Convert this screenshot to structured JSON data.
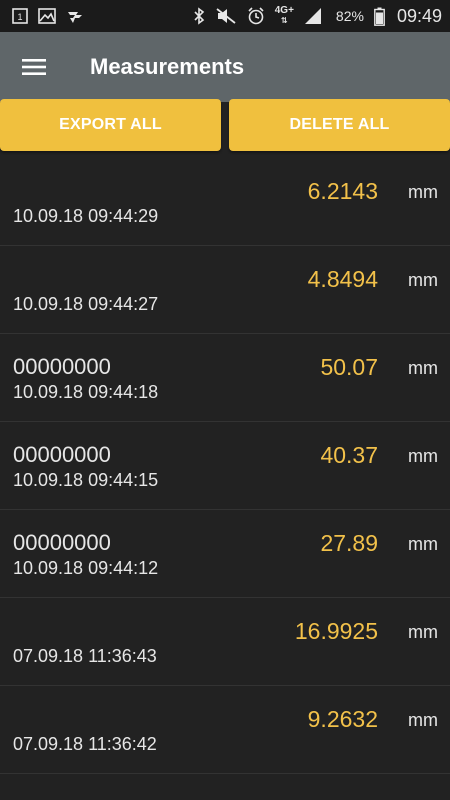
{
  "status_bar": {
    "battery_percent": "82%",
    "time": "09:49",
    "network": "4G+"
  },
  "toolbar": {
    "title": "Measurements"
  },
  "actions": {
    "export_label": "EXPORT ALL",
    "delete_label": "DELETE ALL"
  },
  "accent_color": "#f0c03e",
  "measurements": [
    {
      "name": "",
      "date": "10.09.18 09:44:29",
      "value": "6.2143",
      "unit": "mm"
    },
    {
      "name": "",
      "date": "10.09.18 09:44:27",
      "value": "4.8494",
      "unit": "mm"
    },
    {
      "name": "00000000",
      "date": "10.09.18 09:44:18",
      "value": "50.07",
      "unit": "mm"
    },
    {
      "name": "00000000",
      "date": "10.09.18 09:44:15",
      "value": "40.37",
      "unit": "mm"
    },
    {
      "name": "00000000",
      "date": "10.09.18 09:44:12",
      "value": "27.89",
      "unit": "mm"
    },
    {
      "name": "",
      "date": "07.09.18 11:36:43",
      "value": "16.9925",
      "unit": "mm"
    },
    {
      "name": "",
      "date": "07.09.18 11:36:42",
      "value": "9.2632",
      "unit": "mm"
    }
  ]
}
